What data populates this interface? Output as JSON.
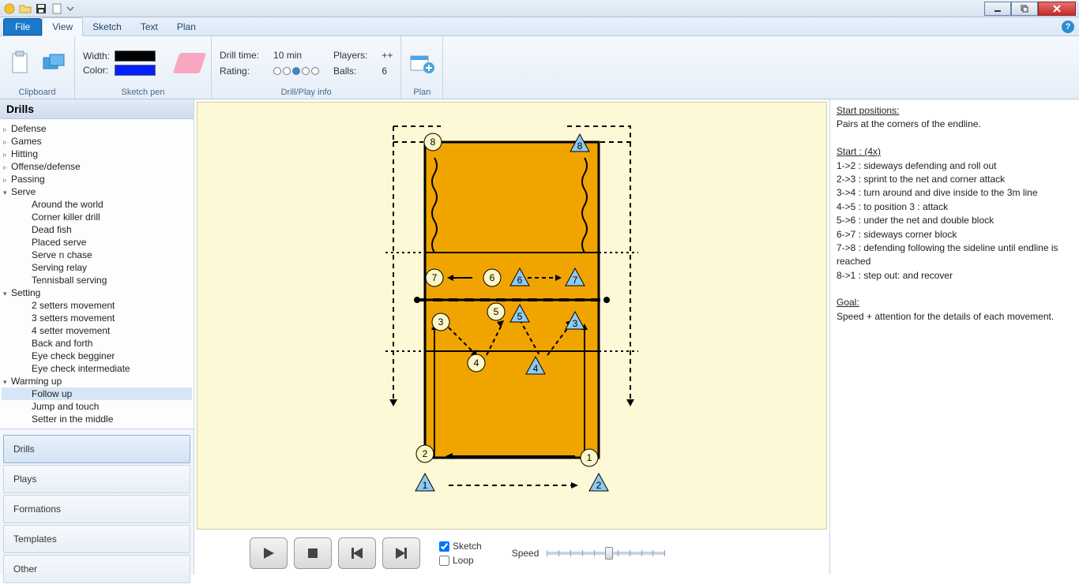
{
  "titlebar": {
    "qat_icons": [
      "app-icon",
      "folder-icon",
      "save-icon",
      "new-icon",
      "dropdown-icon"
    ]
  },
  "tabs": {
    "file": "File",
    "items": [
      "View",
      "Sketch",
      "Text",
      "Plan"
    ],
    "active": "View"
  },
  "ribbon": {
    "clipboard_label": "Clipboard",
    "pen_width_label": "Width:",
    "pen_color_label": "Color:",
    "sketchpen_label": "Sketch pen",
    "info": {
      "drill_time_label": "Drill time:",
      "drill_time_value": "10  min",
      "players_label": "Players:",
      "players_value": "++",
      "rating_label": "Rating:",
      "rating_value": 3,
      "balls_label": "Balls:",
      "balls_value": "6",
      "group_label": "Drill/Play info"
    },
    "plan_label": "Plan"
  },
  "sidebar": {
    "title": "Drills",
    "tree": [
      {
        "label": "Defense",
        "type": "node"
      },
      {
        "label": "Games",
        "type": "node"
      },
      {
        "label": "Hitting",
        "type": "node"
      },
      {
        "label": "Offense/defense",
        "type": "node"
      },
      {
        "label": "Passing",
        "type": "node"
      },
      {
        "label": "Serve",
        "type": "node",
        "open": true,
        "children": [
          "Around the world",
          "Corner killer drill",
          "Dead fish",
          "Placed serve",
          "Serve n chase",
          "Serving relay",
          "Tennisball serving"
        ]
      },
      {
        "label": "Setting",
        "type": "node",
        "open": true,
        "children": [
          "2 setters movement",
          "3 setters movement",
          "4 setter movement",
          "Back and forth",
          "Eye check begginer",
          "Eye check intermediate"
        ]
      },
      {
        "label": "Warming up",
        "type": "node",
        "open": true,
        "children": [
          "Follow up",
          "Jump and touch",
          "Setter in the middle"
        ]
      }
    ],
    "selected_leaf": "Follow up",
    "nav": [
      "Drills",
      "Plays",
      "Formations",
      "Templates",
      "Other"
    ],
    "nav_active": "Drills"
  },
  "canvas": {
    "circle_markers": [
      1,
      2,
      3,
      4,
      5,
      6,
      7,
      8
    ],
    "triangle_markers": [
      1,
      2,
      3,
      4,
      5,
      6,
      7,
      8
    ]
  },
  "playback": {
    "sketch_label": "Sketch",
    "sketch_checked": true,
    "loop_label": "Loop",
    "loop_checked": false,
    "speed_label": "Speed"
  },
  "rightpane": {
    "h1": "Start positions:",
    "p1": "Pairs at the corners of the endline.",
    "h2": "Start :   (4x)",
    "lines": [
      "1->2 : sideways defending and roll out",
      "2->3 : sprint to the net and corner attack",
      "3->4 : turn around and dive inside to the 3m line",
      "4->5 : to position 3 : attack",
      "5->6 : under the net and double block",
      "6->7 : sideways corner block",
      "7->8 : defending following the sideline until endline is reached",
      "8->1 : step out: and recover"
    ],
    "h3": "Goal:",
    "p3": "Speed + attention for the details of each movement."
  }
}
